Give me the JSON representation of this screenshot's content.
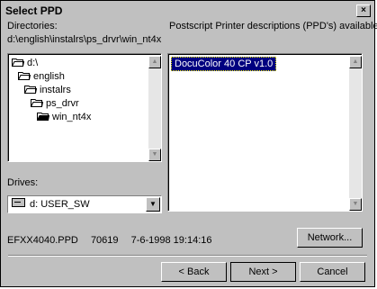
{
  "window": {
    "title": "Select PPD",
    "close_glyph": "×"
  },
  "directories": {
    "label": "Directories:",
    "current_path": "d:\\english\\instalrs\\ps_drvr\\win_nt4x",
    "items": [
      {
        "label": "d:\\",
        "icon": "open-folder-icon"
      },
      {
        "label": "english",
        "icon": "open-folder-icon"
      },
      {
        "label": "instalrs",
        "icon": "open-folder-icon"
      },
      {
        "label": "ps_drvr",
        "icon": "open-folder-icon"
      },
      {
        "label": "win_nt4x",
        "icon": "open-folder-icon"
      }
    ]
  },
  "ppd_list": {
    "label": "Postscript Printer descriptions (PPD's) available:",
    "items": [
      "DocuColor 40 CP v1.0"
    ]
  },
  "drives": {
    "label": "Drives:",
    "selected": "d: USER_SW"
  },
  "file_info": {
    "filename": "EFXX4040.PPD",
    "size": "70619",
    "date": "7-6-1998 19:14:16"
  },
  "buttons": {
    "network": "Network...",
    "back": "< Back",
    "next": "Next >",
    "cancel": "Cancel"
  },
  "scroll_glyphs": {
    "up": "▲",
    "down": "▼"
  }
}
